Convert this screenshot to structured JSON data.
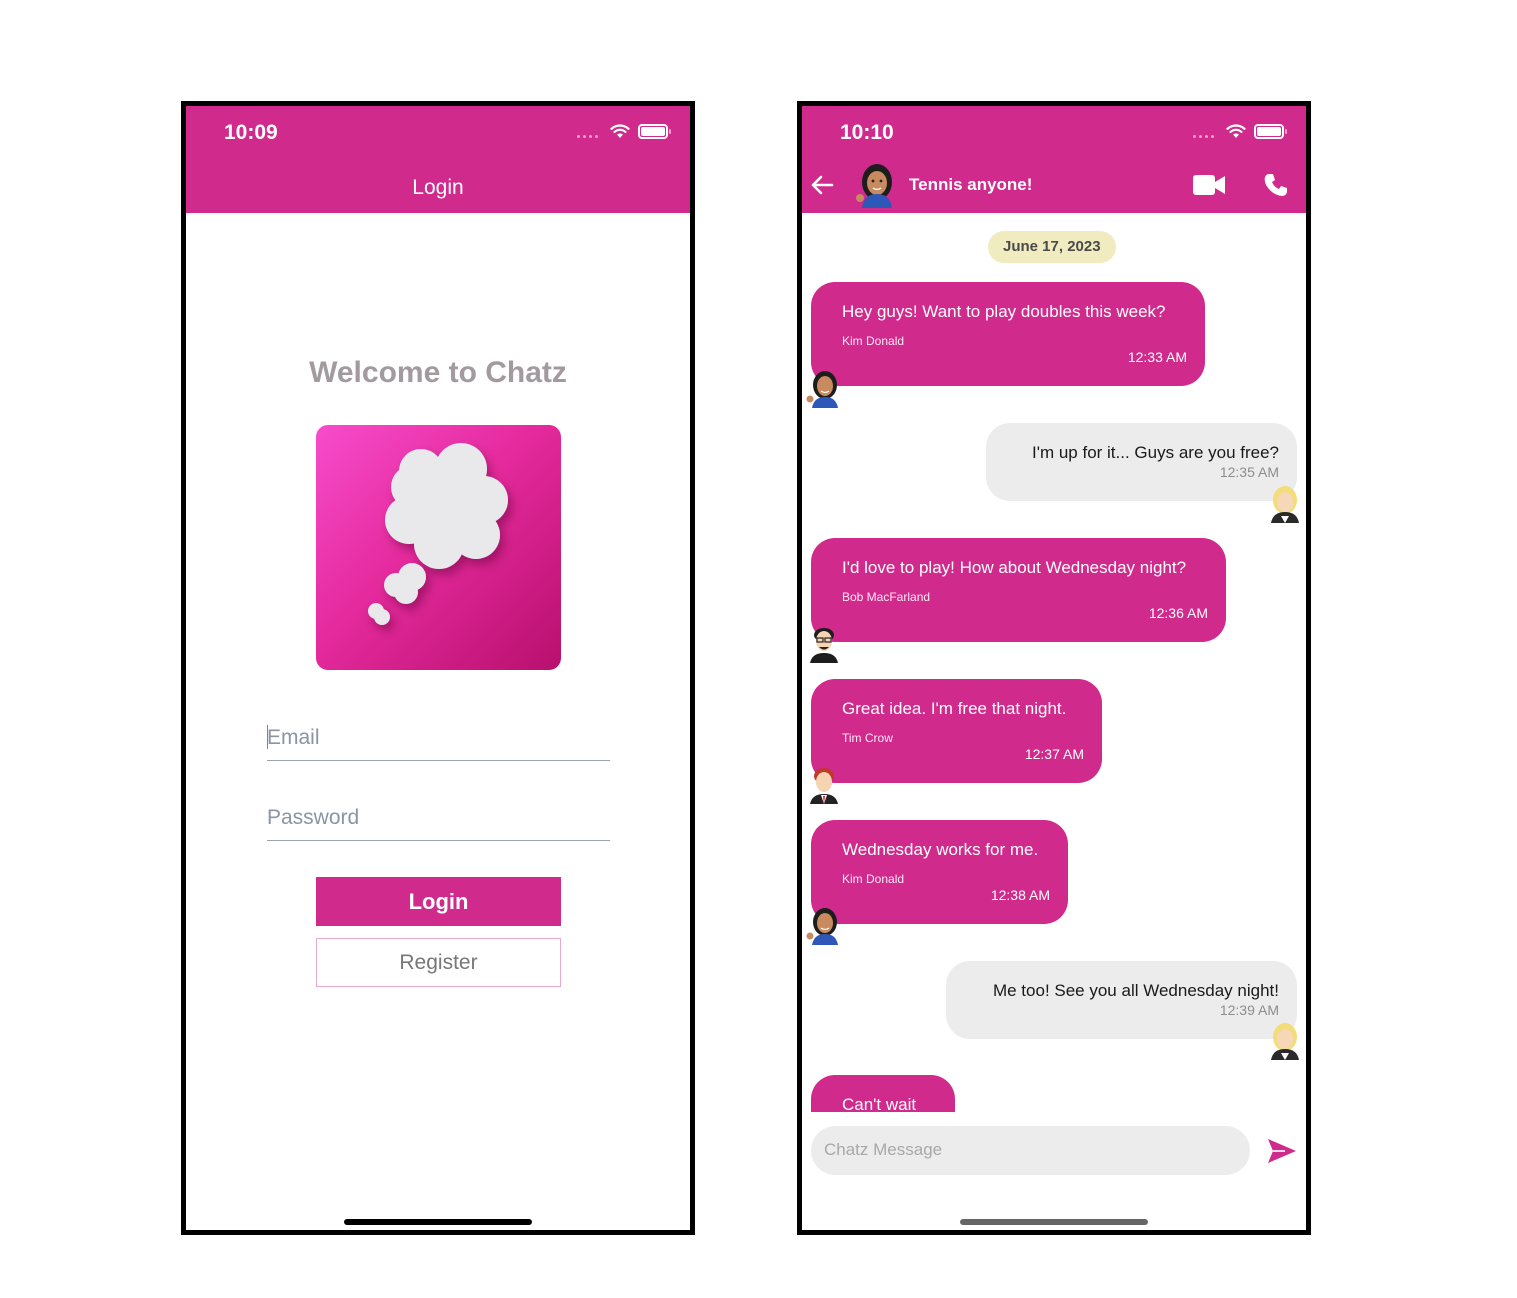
{
  "login_screen": {
    "status_time": "10:09",
    "nav_title": "Login",
    "welcome": "Welcome to Chatz",
    "logo_icon": "thought-bubble-icon",
    "email_placeholder": "Email",
    "password_placeholder": "Password",
    "login_label": "Login",
    "register_label": "Register"
  },
  "chat_screen": {
    "status_time": "10:10",
    "title": "Tennis anyone!",
    "date": "June 17, 2023",
    "composer_placeholder": "Chatz Message",
    "messages": [
      {
        "direction": "in",
        "text": "Hey guys! Want to play doubles this week?",
        "sender": "Kim Donald",
        "time": "12:33 AM",
        "avatar": "woman-dark-hair-avatar"
      },
      {
        "direction": "out",
        "text": "I'm up for it... Guys are you free?",
        "time": "12:35 AM",
        "avatar": "woman-blonde-avatar"
      },
      {
        "direction": "in",
        "text": "I'd love to play! How about Wednesday night?",
        "sender": "Bob MacFarland",
        "time": "12:36 AM",
        "avatar": "man-glasses-avatar"
      },
      {
        "direction": "in",
        "text": "Great idea. I'm free that night.",
        "sender": "Tim Crow",
        "time": "12:37 AM",
        "avatar": "man-red-hair-avatar"
      },
      {
        "direction": "in",
        "text": "Wednesday works for me.",
        "sender": "Kim Donald",
        "time": "12:38 AM",
        "avatar": "woman-dark-hair-avatar"
      },
      {
        "direction": "out",
        "text": "Me too! See you all Wednesday night!",
        "time": "12:39 AM",
        "avatar": "woman-blonde-avatar"
      },
      {
        "direction": "in",
        "text": "Can't wait",
        "sender": "",
        "time": "",
        "avatar": ""
      }
    ]
  },
  "colors": {
    "primary": "#cf2a8c",
    "outgoing_bubble": "#ececec",
    "date_pill": "#f1ebc0",
    "welcome_text": "#a29a9e"
  }
}
